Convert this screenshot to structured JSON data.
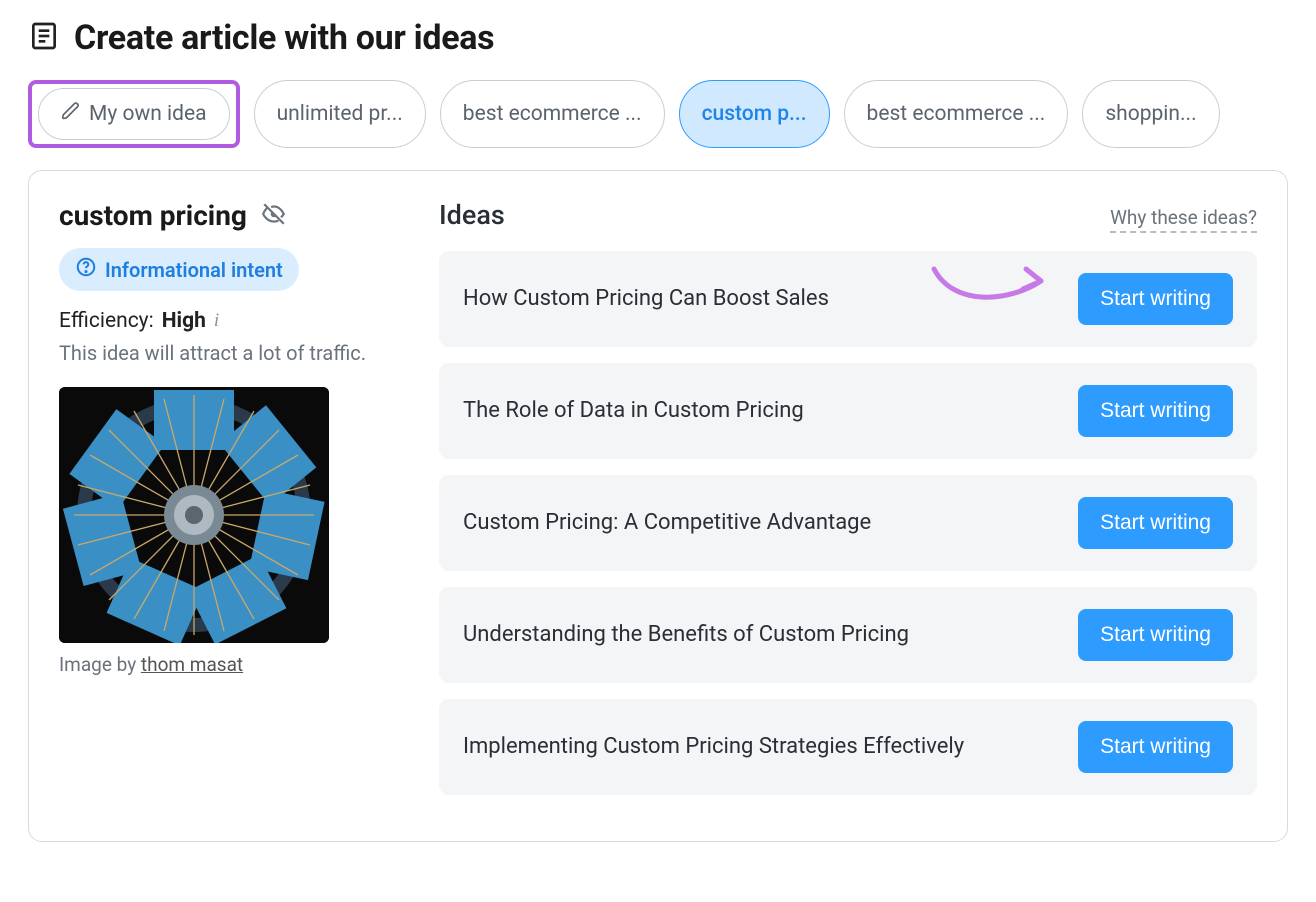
{
  "header": {
    "title": "Create article with our ideas"
  },
  "chips": {
    "my_own": "My own idea",
    "items": [
      "unlimited pr...",
      "best ecommerce ...",
      "custom p...",
      "best ecommerce ...",
      "shoppin..."
    ],
    "active_index": 2
  },
  "topic": {
    "name": "custom pricing",
    "intent_label": "Informational intent",
    "efficiency_label": "Efficiency:",
    "efficiency_value": "High",
    "efficiency_desc": "This idea will attract a lot of traffic.",
    "image_credit_prefix": "Image by ",
    "image_credit_name": "thom masat"
  },
  "ideas": {
    "heading": "Ideas",
    "why_link": "Why these ideas?",
    "start_label": "Start writing",
    "items": [
      "How Custom Pricing Can Boost Sales",
      "The Role of Data in Custom Pricing",
      "Custom Pricing: A Competitive Advantage",
      "Understanding the Benefits of Custom Pricing",
      "Implementing Custom Pricing Strategies Effectively"
    ]
  }
}
